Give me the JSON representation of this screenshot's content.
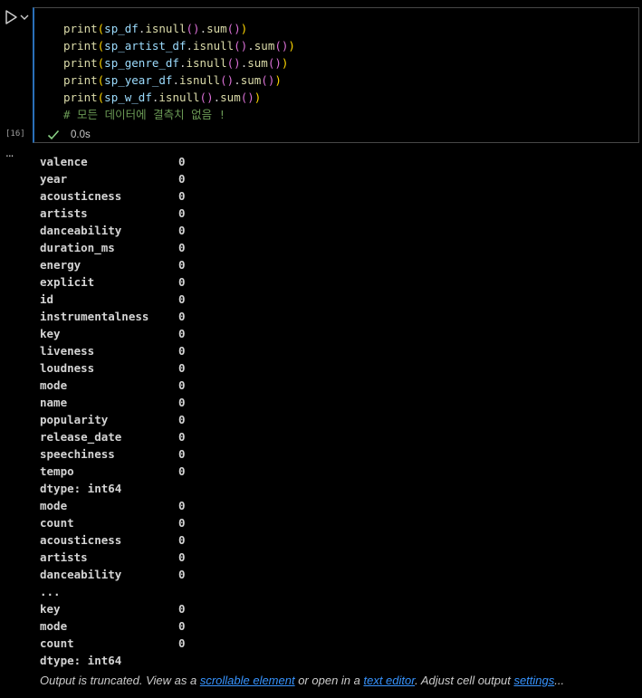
{
  "cell": {
    "execution_count": "[16]",
    "status_time": "0.0s",
    "code_lines": [
      {
        "fn": "print",
        "var": "sp_df",
        "method": "isnull",
        "agg": "sum"
      },
      {
        "fn": "print",
        "var": "sp_artist_df",
        "method": "isnull",
        "agg": "sum"
      },
      {
        "fn": "print",
        "var": "sp_genre_df",
        "method": "isnull",
        "agg": "sum"
      },
      {
        "fn": "print",
        "var": "sp_year_df",
        "method": "isnull",
        "agg": "sum"
      },
      {
        "fn": "print",
        "var": "sp_w_df",
        "method": "isnull",
        "agg": "sum"
      }
    ],
    "comment": "# 모든 데이터에 결측치 없음 !"
  },
  "output": {
    "menu_label": "...",
    "rows": [
      {
        "key": "valence",
        "value": "0"
      },
      {
        "key": "year",
        "value": "0"
      },
      {
        "key": "acousticness",
        "value": "0"
      },
      {
        "key": "artists",
        "value": "0"
      },
      {
        "key": "danceability",
        "value": "0"
      },
      {
        "key": "duration_ms",
        "value": "0"
      },
      {
        "key": "energy",
        "value": "0"
      },
      {
        "key": "explicit",
        "value": "0"
      },
      {
        "key": "id",
        "value": "0"
      },
      {
        "key": "instrumentalness",
        "value": "0"
      },
      {
        "key": "key",
        "value": "0"
      },
      {
        "key": "liveness",
        "value": "0"
      },
      {
        "key": "loudness",
        "value": "0"
      },
      {
        "key": "mode",
        "value": "0"
      },
      {
        "key": "name",
        "value": "0"
      },
      {
        "key": "popularity",
        "value": "0"
      },
      {
        "key": "release_date",
        "value": "0"
      },
      {
        "key": "speechiness",
        "value": "0"
      },
      {
        "key": "tempo",
        "value": "0"
      },
      {
        "key": "dtype: int64",
        "value": ""
      },
      {
        "key": "mode",
        "value": "0"
      },
      {
        "key": "count",
        "value": "0"
      },
      {
        "key": "acousticness",
        "value": "0"
      },
      {
        "key": "artists",
        "value": "0"
      },
      {
        "key": "danceability",
        "value": "0"
      },
      {
        "key": "...",
        "value": ""
      },
      {
        "key": "key",
        "value": "0"
      },
      {
        "key": "mode",
        "value": "0"
      },
      {
        "key": "count",
        "value": "0"
      },
      {
        "key": "dtype: int64",
        "value": ""
      }
    ],
    "truncated": {
      "prefix": "Output is truncated. View as a ",
      "link1": "scrollable element",
      "middle": " or open in a ",
      "link2": "text editor",
      "middle2": ". Adjust cell output ",
      "link3": "settings",
      "suffix": "..."
    }
  },
  "colors": {
    "background": "#000000",
    "cell_border": "#474747",
    "focus_border": "#2a6fb8",
    "check": "#89d185",
    "link": "#3794ff",
    "comment": "#6a9955"
  },
  "icons": {
    "run": "play-icon",
    "run_menu": "chevron-down-icon",
    "status": "check-icon"
  }
}
